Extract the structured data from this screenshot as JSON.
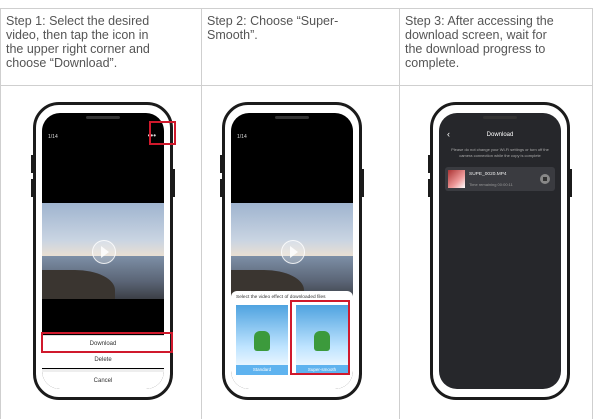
{
  "steps": [
    {
      "text": "Step 1: Select the desired\nvideo, then tap the icon in\nthe upper right corner and\nchoose “Download”."
    },
    {
      "text": "Step 2: Choose “Super-\nSmooth”."
    },
    {
      "text": "Step 3: After accessing the\ndownload screen, wait for\nthe download progress to\ncomplete."
    }
  ],
  "phone1": {
    "counter": "1/14",
    "more_icon": "more-horizontal-icon",
    "menu": [
      "Download",
      "Delete",
      "Cancel"
    ]
  },
  "phone2": {
    "counter": "1/14",
    "prompt": "Select the video effect of downloaded files",
    "options": [
      "Standard",
      "Super-smooth"
    ]
  },
  "phone3": {
    "title": "Download",
    "notice": "Please do not change your Wi-Fi settings or turn off the camera connection while the copy is complete",
    "file_name": "SUPE_0020.MP4",
    "time_remaining": "Time remaining 00:00:11"
  },
  "colors": {
    "highlight": "#d0192c",
    "accent": "#2d8cf0"
  }
}
